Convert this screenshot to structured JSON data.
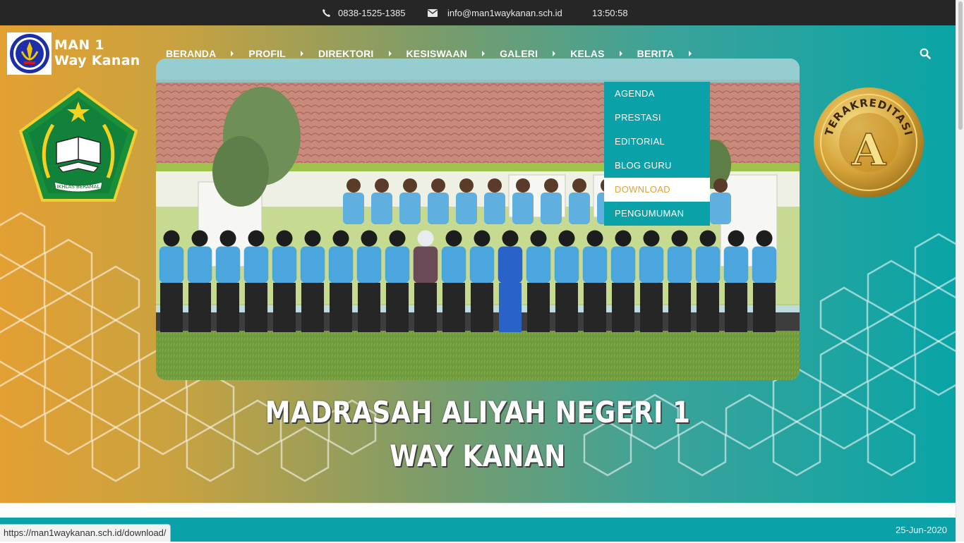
{
  "topbar": {
    "phone": "0838-1525-1385",
    "email": "info@man1waykanan.sch.id",
    "time": "13:50:58",
    "phone_icon": "phone-icon",
    "email_icon": "envelope-icon"
  },
  "brand": {
    "line1": "MAN 1",
    "line2": "Way Kanan"
  },
  "nav": {
    "items": [
      {
        "label": "BERANDA"
      },
      {
        "label": "PROFIL"
      },
      {
        "label": "DIREKTORI"
      },
      {
        "label": "KESISWAAN"
      },
      {
        "label": "GALERI"
      },
      {
        "label": "KELAS"
      },
      {
        "label": "BERITA"
      }
    ],
    "search_icon": "search-icon"
  },
  "dropdown": {
    "items": [
      {
        "label": "AGENDA"
      },
      {
        "label": "PRESTASI"
      },
      {
        "label": "EDITORIAL"
      },
      {
        "label": "BLOG GURU"
      },
      {
        "label": "DOWNLOAD",
        "active": true
      },
      {
        "label": "PENGUMUMAN"
      }
    ]
  },
  "hero": {
    "title_line1": "MADRASAH ALIYAH NEGERI 1",
    "title_line2": "WAY KANAN",
    "emblem_motto": "IKHLAS BERAMAL",
    "badge_text": "TERAKREDITASI",
    "badge_grade": "A"
  },
  "footer": {
    "date": "25-Jun-2020"
  },
  "status": {
    "url": "https://man1waykanan.sch.id/download/"
  },
  "colors": {
    "teal": "#0aa1a8",
    "orange": "#e3a033",
    "topbar": "#262626",
    "active_text": "#e0a23a"
  }
}
